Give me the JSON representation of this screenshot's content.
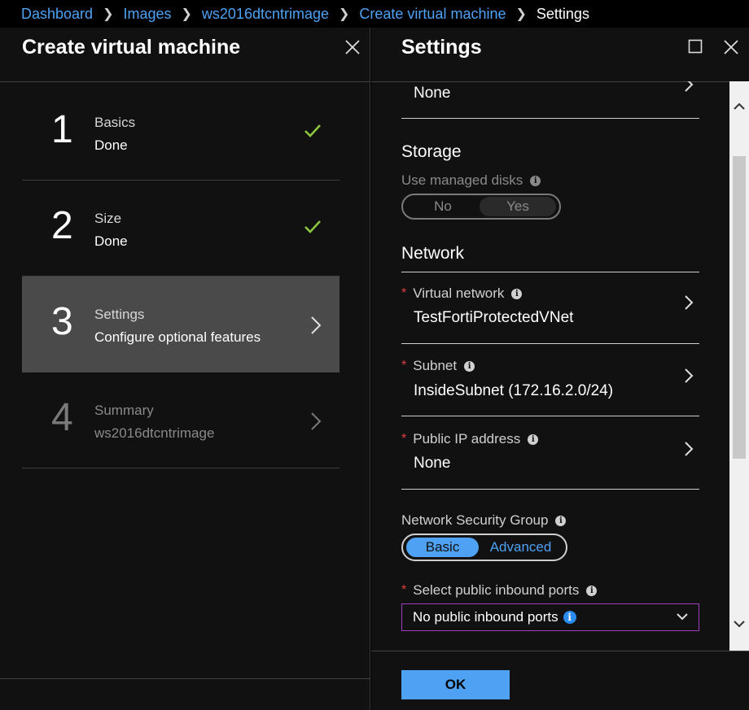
{
  "breadcrumb": [
    {
      "label": "Dashboard"
    },
    {
      "label": "Images"
    },
    {
      "label": "ws2016dtcntrimage"
    },
    {
      "label": "Create virtual machine"
    },
    {
      "label": "Settings"
    }
  ],
  "left_blade": {
    "title": "Create virtual machine",
    "steps": [
      {
        "number": "1",
        "title": "Basics",
        "subtitle": "Done",
        "status": "done"
      },
      {
        "number": "2",
        "title": "Size",
        "subtitle": "Done",
        "status": "done"
      },
      {
        "number": "3",
        "title": "Settings",
        "subtitle": "Configure optional features",
        "status": "active"
      },
      {
        "number": "4",
        "title": "Summary",
        "subtitle": "ws2016dtcntrimage",
        "status": "pending"
      }
    ]
  },
  "right_blade": {
    "title": "Settings",
    "top_value": "None",
    "storage": {
      "heading": "Storage",
      "managed_disks_label": "Use managed disks",
      "options": [
        "No",
        "Yes"
      ],
      "selected": "Yes"
    },
    "network": {
      "heading": "Network",
      "vnet_label": "Virtual network",
      "vnet_value": "TestFortiProtectedVNet",
      "subnet_label": "Subnet",
      "subnet_value": "InsideSubnet (172.16.2.0/24)",
      "pip_label": "Public IP address",
      "pip_value": "None",
      "nsg_label": "Network Security Group",
      "nsg_options": [
        "Basic",
        "Advanced"
      ],
      "nsg_selected": "Basic",
      "ports_label": "Select public inbound ports",
      "ports_value": "No public inbound ports"
    },
    "ok_label": "OK"
  },
  "colors": {
    "link": "#4ea1f3",
    "check": "#8cc63f",
    "required": "#e03e3e",
    "primary_button": "#4ea1f3",
    "select_border": "#a040c0"
  }
}
